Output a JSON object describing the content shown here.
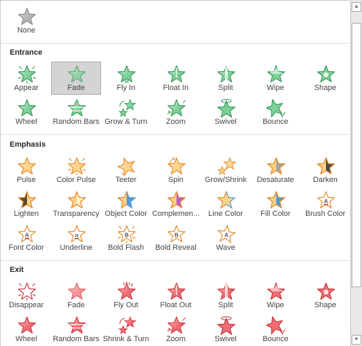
{
  "palette": {
    "entrance": {
      "fill": "#7fd19a",
      "light": "#d8f3e0",
      "stroke": "#3a9a5a"
    },
    "emphasis": {
      "fill": "#fbd48a",
      "light": "#fff1d4",
      "stroke": "#e88a2a"
    },
    "exit": {
      "fill": "#f06d73",
      "light": "#fbd3d5",
      "stroke": "#c93a42"
    },
    "none": {
      "fill": "#b4b4b4",
      "light": "#e0e0e0",
      "stroke": "#8a8a8a"
    },
    "blue": "#4a9de0",
    "purple": "#b75ed1",
    "dark": "#5a4a2e",
    "gray": "#a8a8a8",
    "charcoal": "#4a4a4a",
    "underline_red": "#e03030"
  },
  "none_item": {
    "label": "None",
    "icon": "star-none-icon"
  },
  "sections": [
    {
      "title": "Entrance",
      "theme": "entrance",
      "items": [
        {
          "label": "Appear",
          "icon": "appear-star-icon",
          "deco": "rays"
        },
        {
          "label": "Fade",
          "icon": "fade-star-icon",
          "deco": "fade",
          "selected": true
        },
        {
          "label": "Fly In",
          "icon": "fly-in-star-icon",
          "deco": "flyin"
        },
        {
          "label": "Float In",
          "icon": "float-in-star-icon",
          "deco": "float"
        },
        {
          "label": "Split",
          "icon": "split-star-icon",
          "deco": "split"
        },
        {
          "label": "Wipe",
          "icon": "wipe-star-icon",
          "deco": "wipe"
        },
        {
          "label": "Shape",
          "icon": "shape-star-icon",
          "deco": "shape"
        },
        {
          "label": "Wheel",
          "icon": "wheel-star-icon",
          "deco": "plain"
        },
        {
          "label": "Random Bars",
          "icon": "random-bars-star-icon",
          "deco": "bars"
        },
        {
          "label": "Grow & Turn",
          "icon": "grow-turn-star-icon",
          "deco": "growturn"
        },
        {
          "label": "Zoom",
          "icon": "zoom-star-icon",
          "deco": "zoom"
        },
        {
          "label": "Swivel",
          "icon": "swivel-star-icon",
          "deco": "swivel"
        },
        {
          "label": "Bounce",
          "icon": "bounce-star-icon",
          "deco": "bounce"
        }
      ]
    },
    {
      "title": "Emphasis",
      "theme": "emphasis",
      "items": [
        {
          "label": "Pulse",
          "icon": "pulse-star-icon",
          "deco": "pulse"
        },
        {
          "label": "Color Pulse",
          "icon": "color-pulse-star-icon",
          "deco": "rays"
        },
        {
          "label": "Teeter",
          "icon": "teeter-star-icon",
          "deco": "teeter"
        },
        {
          "label": "Spin",
          "icon": "spin-star-icon",
          "deco": "spin"
        },
        {
          "label": "Grow/Shrink",
          "icon": "grow-shrink-star-icon",
          "deco": "growshrink"
        },
        {
          "label": "Desaturate",
          "icon": "desaturate-star-icon",
          "deco": "half-gray"
        },
        {
          "label": "Darken",
          "icon": "darken-star-icon",
          "deco": "half-charcoal"
        },
        {
          "label": "Lighten",
          "icon": "lighten-star-icon",
          "deco": "half-dark-left"
        },
        {
          "label": "Transparency",
          "icon": "transparency-star-icon",
          "deco": "transparent"
        },
        {
          "label": "Object Color",
          "icon": "object-color-star-icon",
          "deco": "half-blue"
        },
        {
          "label": "Complemen...",
          "icon": "complementary-color-star-icon",
          "deco": "half-purple"
        },
        {
          "label": "Line Color",
          "icon": "line-color-star-icon",
          "deco": "blue-line"
        },
        {
          "label": "Fill Color",
          "icon": "fill-color-star-icon",
          "deco": "half-blue-fill"
        },
        {
          "label": "Brush Color",
          "icon": "brush-color-star-icon",
          "deco": "letter-a-red"
        },
        {
          "label": "Font Color",
          "icon": "font-color-star-icon",
          "deco": "letter-a-red"
        },
        {
          "label": "Underline",
          "icon": "underline-star-icon",
          "deco": "letter-u"
        },
        {
          "label": "Bold Flash",
          "icon": "bold-flash-star-icon",
          "deco": "letter-b-rays"
        },
        {
          "label": "Bold Reveal",
          "icon": "bold-reveal-star-icon",
          "deco": "letter-b"
        },
        {
          "label": "Wave",
          "icon": "wave-star-icon",
          "deco": "letter-a-wave"
        }
      ]
    },
    {
      "title": "Exit",
      "theme": "exit",
      "items": [
        {
          "label": "Disappear",
          "icon": "disappear-star-icon",
          "deco": "outline-rays"
        },
        {
          "label": "Fade",
          "icon": "fade-star-icon",
          "deco": "fade"
        },
        {
          "label": "Fly Out",
          "icon": "fly-out-star-icon",
          "deco": "flyout"
        },
        {
          "label": "Float Out",
          "icon": "float-out-star-icon",
          "deco": "float"
        },
        {
          "label": "Split",
          "icon": "split-star-icon",
          "deco": "split"
        },
        {
          "label": "Wipe",
          "icon": "wipe-star-icon",
          "deco": "wipe"
        },
        {
          "label": "Shape",
          "icon": "shape-star-icon",
          "deco": "shape"
        },
        {
          "label": "Wheel",
          "icon": "wheel-star-icon",
          "deco": "plain"
        },
        {
          "label": "Random Bars",
          "icon": "random-bars-star-icon",
          "deco": "bars"
        },
        {
          "label": "Shrink & Turn",
          "icon": "shrink-turn-star-icon",
          "deco": "growturn"
        },
        {
          "label": "Zoom",
          "icon": "zoom-star-icon",
          "deco": "zoom"
        },
        {
          "label": "Swivel",
          "icon": "swivel-star-icon",
          "deco": "swivel"
        },
        {
          "label": "Bounce",
          "icon": "bounce-star-icon",
          "deco": "bounce"
        }
      ]
    }
  ],
  "scrollbar": {
    "up_label": "▲",
    "down_label": "▼",
    "position_fraction": 0.0
  }
}
